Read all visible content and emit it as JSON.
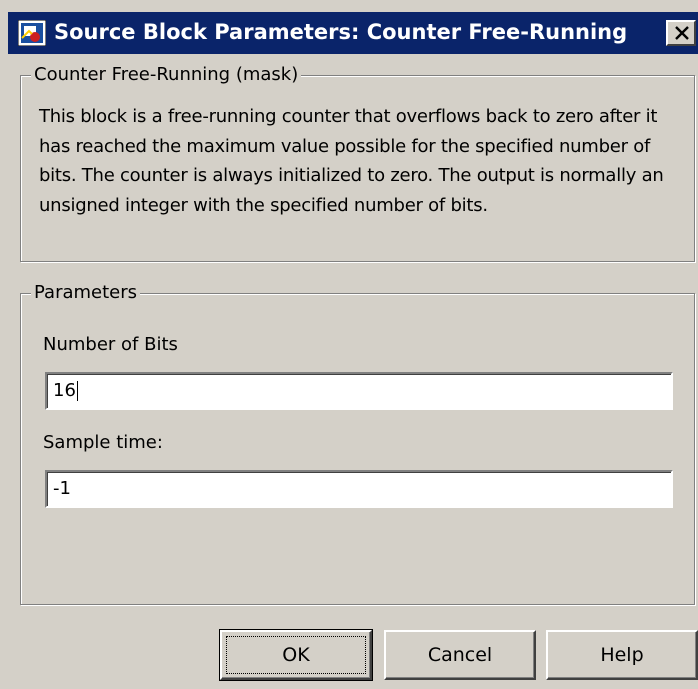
{
  "window": {
    "title": "Source Block Parameters: Counter Free-Running",
    "app_icon": "simulink-block-icon",
    "close_icon": "close-icon"
  },
  "description_group": {
    "legend": "Counter Free-Running (mask)",
    "text": "This block is a free-running counter that overflows back to zero after it has reached the maximum value possible for the specified number of bits. The counter is always initialized to zero.  The output is normally an unsigned integer with the specified number of bits."
  },
  "parameters_group": {
    "legend": "Parameters",
    "number_of_bits": {
      "label": "Number of Bits",
      "value": "16"
    },
    "sample_time": {
      "label": "Sample time:",
      "value": "-1"
    }
  },
  "buttons": {
    "ok": "OK",
    "cancel": "Cancel",
    "help": "Help"
  },
  "colors": {
    "titlebar": "#0a246a",
    "dialog_face": "#d4d0c8"
  }
}
